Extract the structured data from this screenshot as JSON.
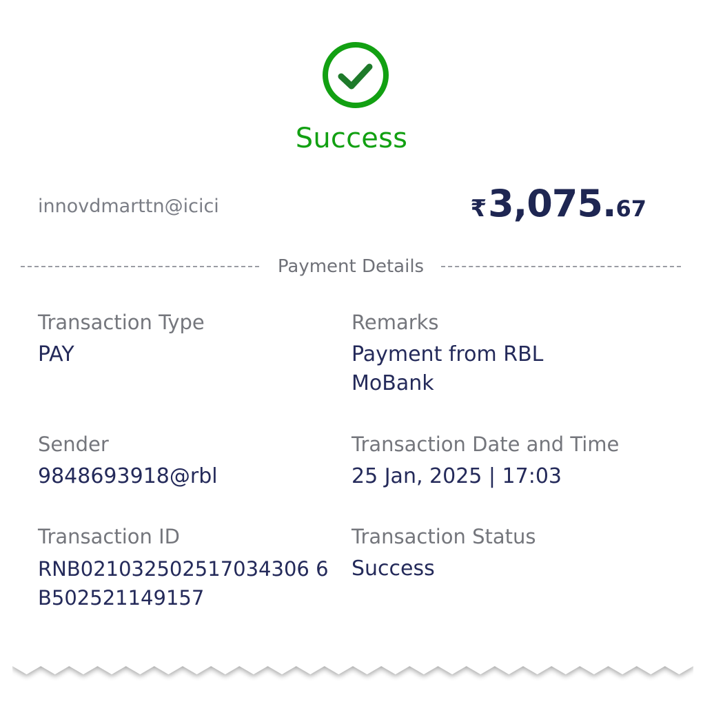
{
  "status": {
    "icon": "check-circle-icon",
    "title": "Success",
    "color": "#12a012"
  },
  "payee": {
    "id": "innovdmarttn@icici"
  },
  "amount": {
    "currency": "₹",
    "integer": "3,075.",
    "decimal": "67"
  },
  "section": {
    "title": "Payment Details"
  },
  "details": {
    "transaction_type": {
      "label": "Transaction Type",
      "value": "PAY"
    },
    "remarks": {
      "label": "Remarks",
      "value": "Payment from RBL MoBank"
    },
    "sender": {
      "label": "Sender",
      "value": "9848693918@rbl"
    },
    "date_time": {
      "label": "Transaction Date and Time",
      "value": "25 Jan, 2025 | 17:03"
    },
    "transaction_id": {
      "label": "Transaction ID",
      "value": "RNB021032502517034306 6B502521149157"
    },
    "transaction_status": {
      "label": "Transaction Status",
      "value": "Success"
    }
  },
  "colors": {
    "accent_dark": "#1e2652",
    "label_grey": "#74767c",
    "success_green": "#12a012"
  }
}
